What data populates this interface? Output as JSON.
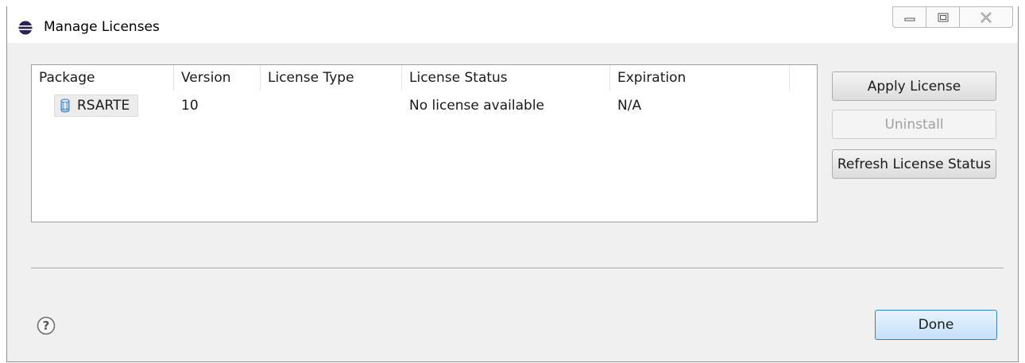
{
  "window": {
    "title": "Manage Licenses",
    "controls": [
      "minimize-icon",
      "maximize-icon",
      "close-icon"
    ]
  },
  "table": {
    "columns": [
      "Package",
      "Version",
      "License Type",
      "License Status",
      "Expiration"
    ],
    "rows": [
      {
        "package": "RSARTE",
        "version": "10",
        "license_type": "",
        "license_status": "No license available",
        "expiration": "N/A"
      }
    ]
  },
  "buttons": {
    "apply_license": "Apply License",
    "uninstall": "Uninstall",
    "refresh_license_status": "Refresh License Status",
    "done": "Done"
  },
  "icons": {
    "app": "eclipse-icon",
    "package": "package-icon",
    "help": "help-icon"
  }
}
